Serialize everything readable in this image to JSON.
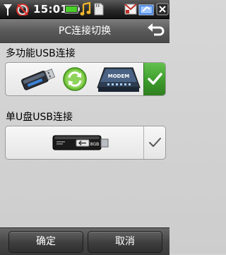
{
  "status_bar": {
    "time": "15:01",
    "icons": [
      "signal-icon",
      "alarm-off-icon",
      "battery-icon",
      "music-note-icon",
      "sd-card-icon",
      "mail-icon",
      "usb-connection-icon",
      "close-icon"
    ]
  },
  "header": {
    "title": "PC连接切换",
    "back_icon": "back-arrow-icon"
  },
  "options": [
    {
      "label": "多功能USB连接",
      "icons": [
        "usb-drive-icon",
        "sync-icon",
        "modem-icon"
      ],
      "modem_text": "MODEM",
      "selected": true
    },
    {
      "label": "单U盘USB连接",
      "icons": [
        "usb-disk-icon"
      ],
      "disk_text": "8GB",
      "selected": false
    }
  ],
  "footer": {
    "ok_label": "确定",
    "cancel_label": "取消"
  },
  "colors": {
    "selected_green": "#3d9c2c",
    "title_bar": "#5a5a5a",
    "status_bar": "#1c1c1c",
    "background": "#d2d2d2"
  }
}
